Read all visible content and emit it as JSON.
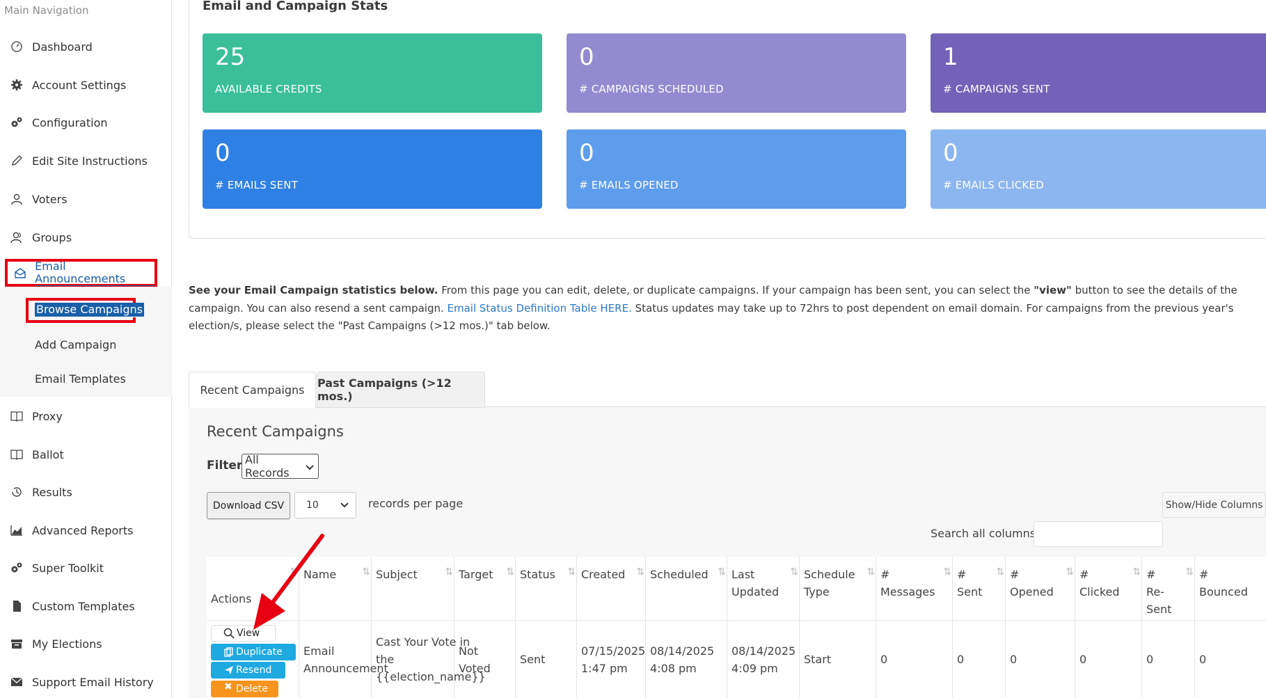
{
  "sidebar": {
    "caption": "Main Navigation",
    "items": [
      {
        "label": "Dashboard",
        "icon": "dashboard-icon"
      },
      {
        "label": "Account Settings",
        "icon": "gear-icon"
      },
      {
        "label": "Configuration",
        "icon": "gears-icon"
      },
      {
        "label": "Edit Site Instructions",
        "icon": "pencil-icon"
      },
      {
        "label": "Voters",
        "icon": "user-icon"
      },
      {
        "label": "Groups",
        "icon": "users-icon"
      },
      {
        "label": "Email Announcements",
        "icon": "envelope-open-icon"
      },
      {
        "label": "Proxy",
        "icon": "book-icon"
      },
      {
        "label": "Ballot",
        "icon": "book-icon"
      },
      {
        "label": "Results",
        "icon": "history-icon"
      },
      {
        "label": "Advanced Reports",
        "icon": "area-chart-icon"
      },
      {
        "label": "Super Toolkit",
        "icon": "gears-icon"
      },
      {
        "label": "Custom Templates",
        "icon": "file-icon"
      },
      {
        "label": "My Elections",
        "icon": "archive-icon"
      },
      {
        "label": "Support Email History",
        "icon": "envelope-icon"
      }
    ],
    "subitems": [
      "Browse Campaigns",
      "Add Campaign",
      "Email Templates"
    ]
  },
  "stats": {
    "title": "Email and Campaign Stats",
    "cards": [
      {
        "value": "25",
        "label": "AVAILABLE CREDITS",
        "color": "#3abf9a"
      },
      {
        "value": "0",
        "label": "# CAMPAIGNS SCHEDULED",
        "color": "#948ad0"
      },
      {
        "value": "1",
        "label": "# CAMPAIGNS SENT",
        "color": "#7262b8"
      },
      {
        "value": "0",
        "label": "# EMAILS SENT",
        "color": "#2f80e4"
      },
      {
        "value": "0",
        "label": "# EMAILS OPENED",
        "color": "#5d9deb"
      },
      {
        "value": "0",
        "label": "# EMAILS CLICKED",
        "color": "#8cb6ef"
      }
    ]
  },
  "description": {
    "bold": "See your Email Campaign statistics below.",
    "part1": " From this page you can edit, delete, or duplicate campaigns.  If your campaign has been sent, you can select the ",
    "view_word": "\"view\"",
    "part2": " button to see the details of the campaign.  You can also resend a sent campaign. ",
    "link": "Email Status Definition Table HERE.",
    "part3": "  Status updates may take up to 72hrs to post dependent on email domain.  For campaigns from the previous year's election/s, please select the \"Past Campaigns (>12 mos.)\" tab below."
  },
  "tabs": [
    "Recent Campaigns",
    "Past Campaigns (>12 mos.)"
  ],
  "section_title": "Recent Campaigns",
  "filter": {
    "label": "Filter:",
    "value": "All Records"
  },
  "download_csv": "Download CSV",
  "per_page": {
    "value": "10",
    "label": "records per page"
  },
  "show_hide": "Show/Hide Columns",
  "search_label": "Search all columns:",
  "table": {
    "headers": [
      "Actions",
      "Name",
      "Subject",
      "Target",
      "Status",
      "Created",
      "Scheduled",
      "Last Updated",
      "Schedule Type",
      "# Messages",
      "# Sent",
      "# Opened",
      "# Clicked",
      "# Re-Sent",
      "# Bounced"
    ],
    "row": {
      "name": "Email Announcement",
      "subject": "Cast Your Vote in the {{election_name}}",
      "target": "Not Voted",
      "status": "Sent",
      "created": "07/15/2025 1:47 pm",
      "scheduled": "08/14/2025 4:08 pm",
      "last_updated": "08/14/2025 4:09 pm",
      "schedule_type": "Start",
      "messages": "0",
      "sent": "0",
      "opened": "0",
      "clicked": "0",
      "resent": "0",
      "bounced": "0"
    },
    "actions": [
      "View",
      "Duplicate",
      "Resend",
      "Delete"
    ]
  }
}
